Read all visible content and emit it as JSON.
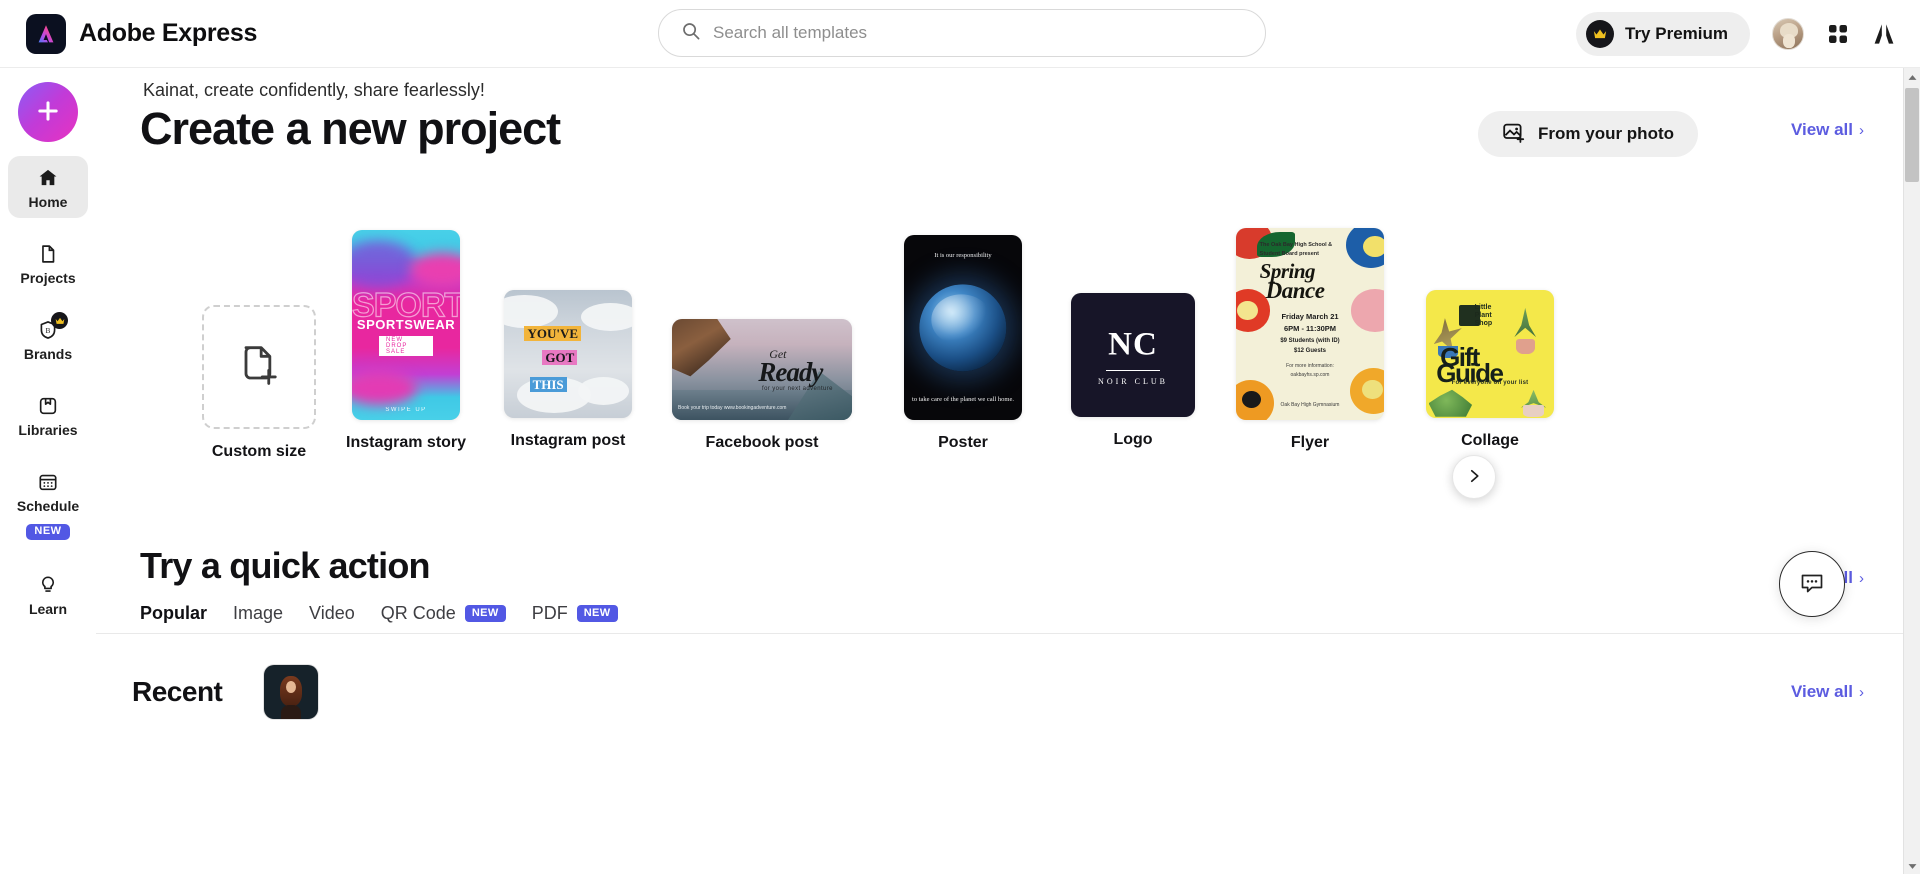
{
  "topbar": {
    "brand_name": "Adobe Express",
    "brand_icon": "adobe-express-logo-icon",
    "search": {
      "placeholder": "Search all templates",
      "value": "",
      "icon": "search-icon"
    },
    "premium": {
      "label": "Try Premium",
      "icon": "crown-icon"
    },
    "avatar": {
      "name": "user-avatar"
    },
    "apps_icon": "apps-grid-icon",
    "adobe_icon": "adobe-logo-icon"
  },
  "sidebar": {
    "create_button": {
      "label": "",
      "icon": "plus-icon"
    },
    "items": [
      {
        "label": "Home",
        "icon": "home-icon",
        "active": true,
        "badge": ""
      },
      {
        "label": "Projects",
        "icon": "file-icon",
        "active": false,
        "badge": ""
      },
      {
        "label": "Brands",
        "icon": "brand-shield-icon",
        "active": false,
        "badge": "crown"
      },
      {
        "label": "Libraries",
        "icon": "library-box-icon",
        "active": false,
        "badge": ""
      },
      {
        "label": "Schedule",
        "icon": "calendar-icon",
        "active": false,
        "badge": "NEW"
      },
      {
        "label": "Learn",
        "icon": "lightbulb-icon",
        "active": false,
        "badge": ""
      }
    ]
  },
  "main": {
    "greeting": "Kainat, create confidently, share fearlessly!",
    "title": "Create a new project",
    "from_photo": {
      "label": "From your photo",
      "icon": "image-plus-icon"
    },
    "view_all": "View all",
    "next_arrow_icon": "chevron-right-icon",
    "cards": [
      {
        "label": "Custom size",
        "kind": "custom"
      },
      {
        "label": "Instagram story",
        "kind": "igstory",
        "art": {
          "ghost": "SPORTSW",
          "headline": "SPORTSWEAR",
          "sub": "NEW DROP SALE",
          "footer": "SWIPE UP"
        }
      },
      {
        "label": "Instagram post",
        "kind": "igpost",
        "art": {
          "line1": "YOU'VE",
          "line2": "GOT",
          "line3": "THIS"
        }
      },
      {
        "label": "Facebook post",
        "kind": "facebook",
        "art": {
          "get": "Get",
          "ready": "Ready",
          "tagline": "for your next adventure",
          "footer": "Book your trip today\nwww.bookingadventure.com"
        }
      },
      {
        "label": "Poster",
        "kind": "poster",
        "art": {
          "top": "It is our responsibility",
          "bottom": "to take care of the planet we call home."
        }
      },
      {
        "label": "Logo",
        "kind": "logo",
        "art": {
          "monogram": "NC",
          "name": "NOIR CLUB"
        }
      },
      {
        "label": "Flyer",
        "kind": "flyer",
        "art": {
          "presenter": "The Oak Bay High School &\nStudent Board present",
          "title1": "Spring",
          "title2": "Dance",
          "date": "Friday March 21\n6PM - 11:30PM",
          "price": "$9 Students (with ID)\n$12 Guests",
          "info": "For more information:\noakbayhs.sp.com",
          "venue": "Oak Bay High Gymnasium"
        }
      },
      {
        "label": "Collage",
        "kind": "collage",
        "art": {
          "shop": "Little\nPlant\nShop",
          "title1": "Gift",
          "title2": "Guide",
          "sub": "For everyone on your list"
        }
      }
    ],
    "quick_action": {
      "title": "Try a quick action",
      "view_all": "View all",
      "tabs": [
        {
          "label": "Popular",
          "active": true,
          "badge": ""
        },
        {
          "label": "Image",
          "active": false,
          "badge": ""
        },
        {
          "label": "Video",
          "active": false,
          "badge": ""
        },
        {
          "label": "QR Code",
          "active": false,
          "badge": "NEW"
        },
        {
          "label": "PDF",
          "active": false,
          "badge": "NEW"
        }
      ]
    },
    "recent": {
      "title": "Recent",
      "view_all": "View all",
      "items": [
        {
          "name": "recent-project-thumbnail"
        }
      ]
    },
    "chat_fab": {
      "icon": "chat-bubble-icon"
    }
  },
  "colors": {
    "accent_purple": "#5c5ce0",
    "badge_blue": "#5258e4",
    "panel_gray": "#efefef",
    "text_dark": "#111114"
  },
  "scrollbar": {
    "up_icon": "caret-up-icon",
    "down_icon": "caret-down-icon"
  }
}
